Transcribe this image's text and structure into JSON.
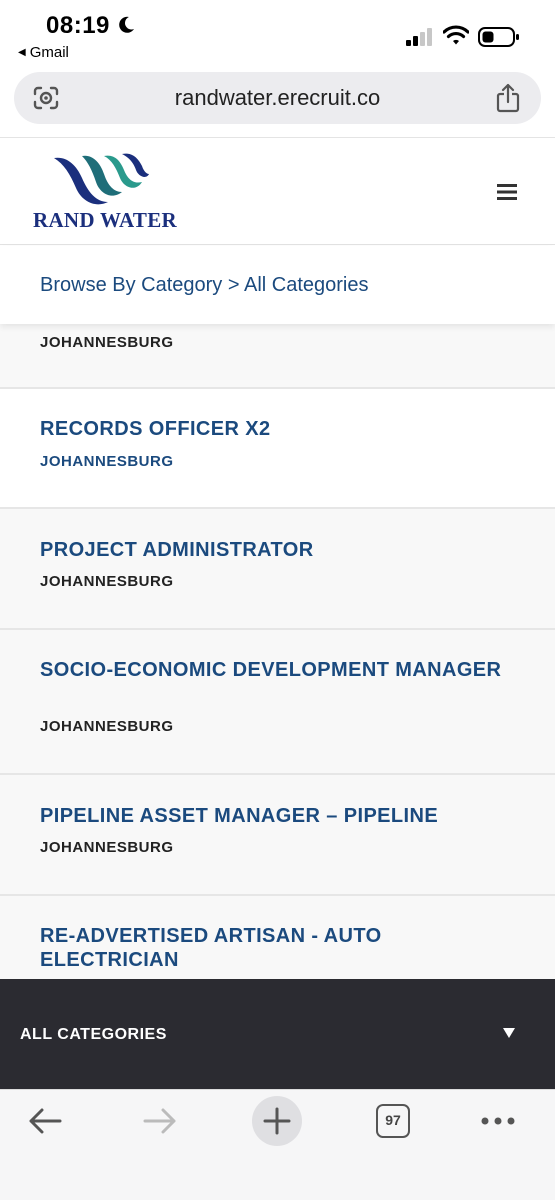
{
  "status_bar": {
    "time": "08:19",
    "back_app": "Gmail",
    "icons": [
      "moon-icon",
      "signal-icon",
      "wifi-icon",
      "battery-icon"
    ]
  },
  "browser": {
    "url": "randwater.erecruit.co",
    "tab_count": "97",
    "icons": [
      "lens-icon",
      "share-icon",
      "back-arrow-icon",
      "forward-arrow-icon",
      "plus-icon",
      "more-icon"
    ]
  },
  "site": {
    "logo_text": "RAND WATER",
    "breadcrumb": "Browse By Category > All Categories",
    "brand_color": "#1b4a7e"
  },
  "jobs": [
    {
      "title": "",
      "location": "JOHANNESBURG"
    },
    {
      "title": "RECORDS OFFICER X2",
      "location": "JOHANNESBURG"
    },
    {
      "title": "PROJECT ADMINISTRATOR",
      "location": "JOHANNESBURG"
    },
    {
      "title": "SOCIO-ECONOMIC DEVELOPMENT MANAGER",
      "location": "JOHANNESBURG"
    },
    {
      "title": "PIPELINE ASSET MANAGER – PIPELINE",
      "location": "JOHANNESBURG"
    },
    {
      "title": "RE-ADVERTISED ARTISAN - AUTO ELECTRICIAN",
      "location": ""
    }
  ],
  "category_filter": {
    "label": "ALL CATEGORIES"
  }
}
